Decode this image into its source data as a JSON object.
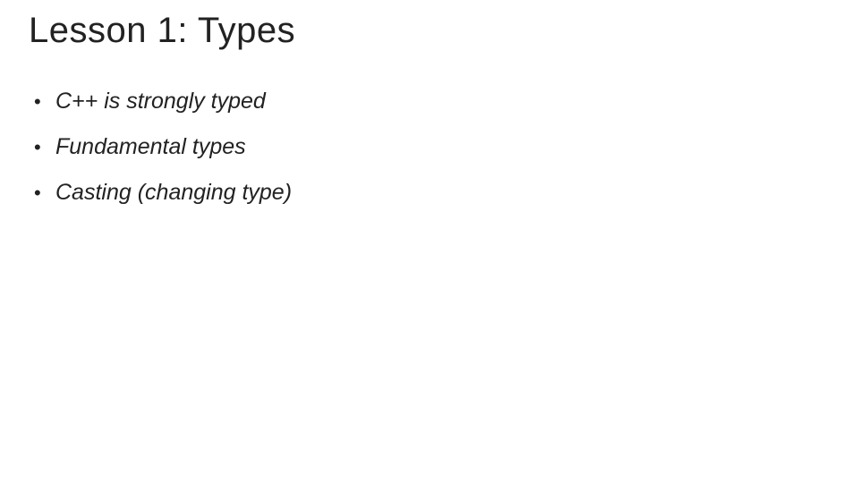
{
  "slide": {
    "title": "Lesson 1: Types",
    "bullets": [
      "C++ is strongly typed",
      "Fundamental types",
      "Casting (changing type)"
    ]
  }
}
